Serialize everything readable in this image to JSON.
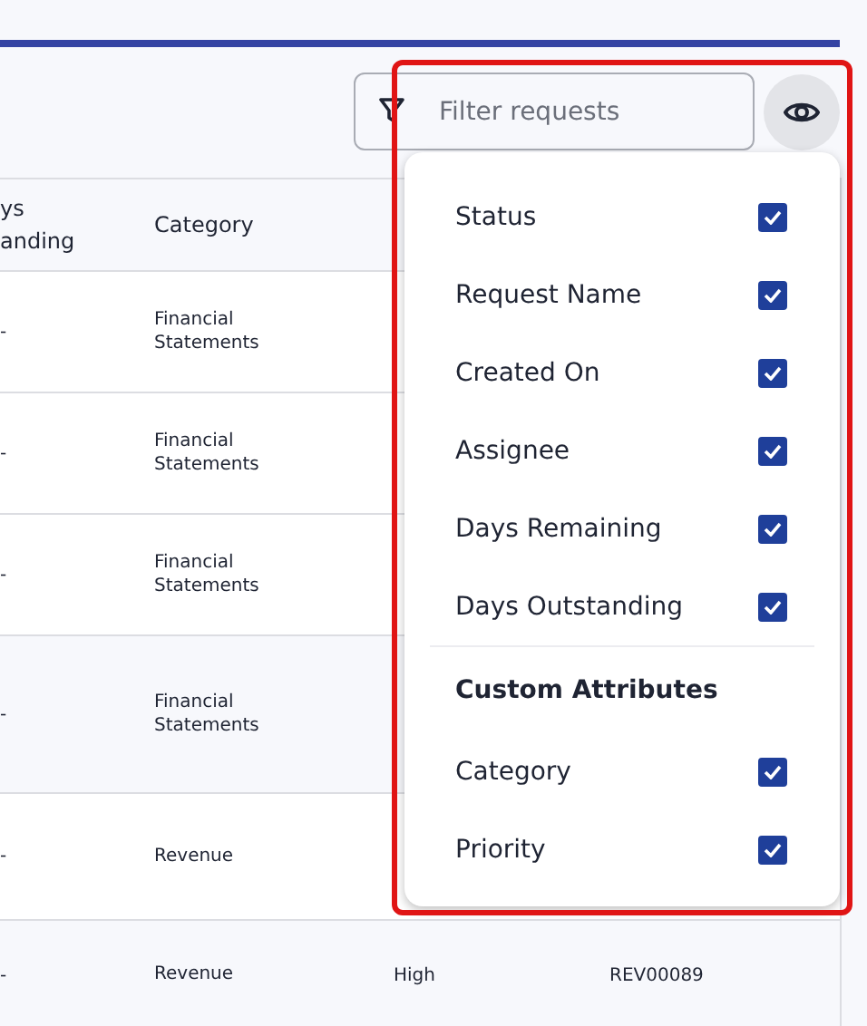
{
  "toolbar": {
    "filter": {
      "placeholder": "Filter requests"
    }
  },
  "table": {
    "columns": {
      "column_1": "ys anding",
      "category": "Category"
    },
    "rows": [
      {
        "column_1": "-",
        "category": "Financial Statements"
      },
      {
        "column_1": "-",
        "category": "Financial Statements"
      },
      {
        "column_1": "-",
        "category": "Financial Statements"
      },
      {
        "column_1": "-",
        "category": "Financial Statements"
      },
      {
        "column_1": "-",
        "category": "Revenue"
      },
      {
        "column_1": "-",
        "category": "Revenue",
        "column_3": "High",
        "column_4": "REV00089"
      }
    ]
  },
  "column_menu": {
    "items": [
      {
        "label": "Status",
        "checked": true
      },
      {
        "label": "Request Name",
        "checked": true
      },
      {
        "label": "Created On",
        "checked": true
      },
      {
        "label": "Assignee",
        "checked": true
      },
      {
        "label": "Days Remaining",
        "checked": true
      },
      {
        "label": "Days Outstanding",
        "checked": true
      }
    ],
    "section_title": "Custom Attributes",
    "custom_items": [
      {
        "label": "Category",
        "checked": true
      },
      {
        "label": "Priority",
        "checked": true
      }
    ]
  }
}
